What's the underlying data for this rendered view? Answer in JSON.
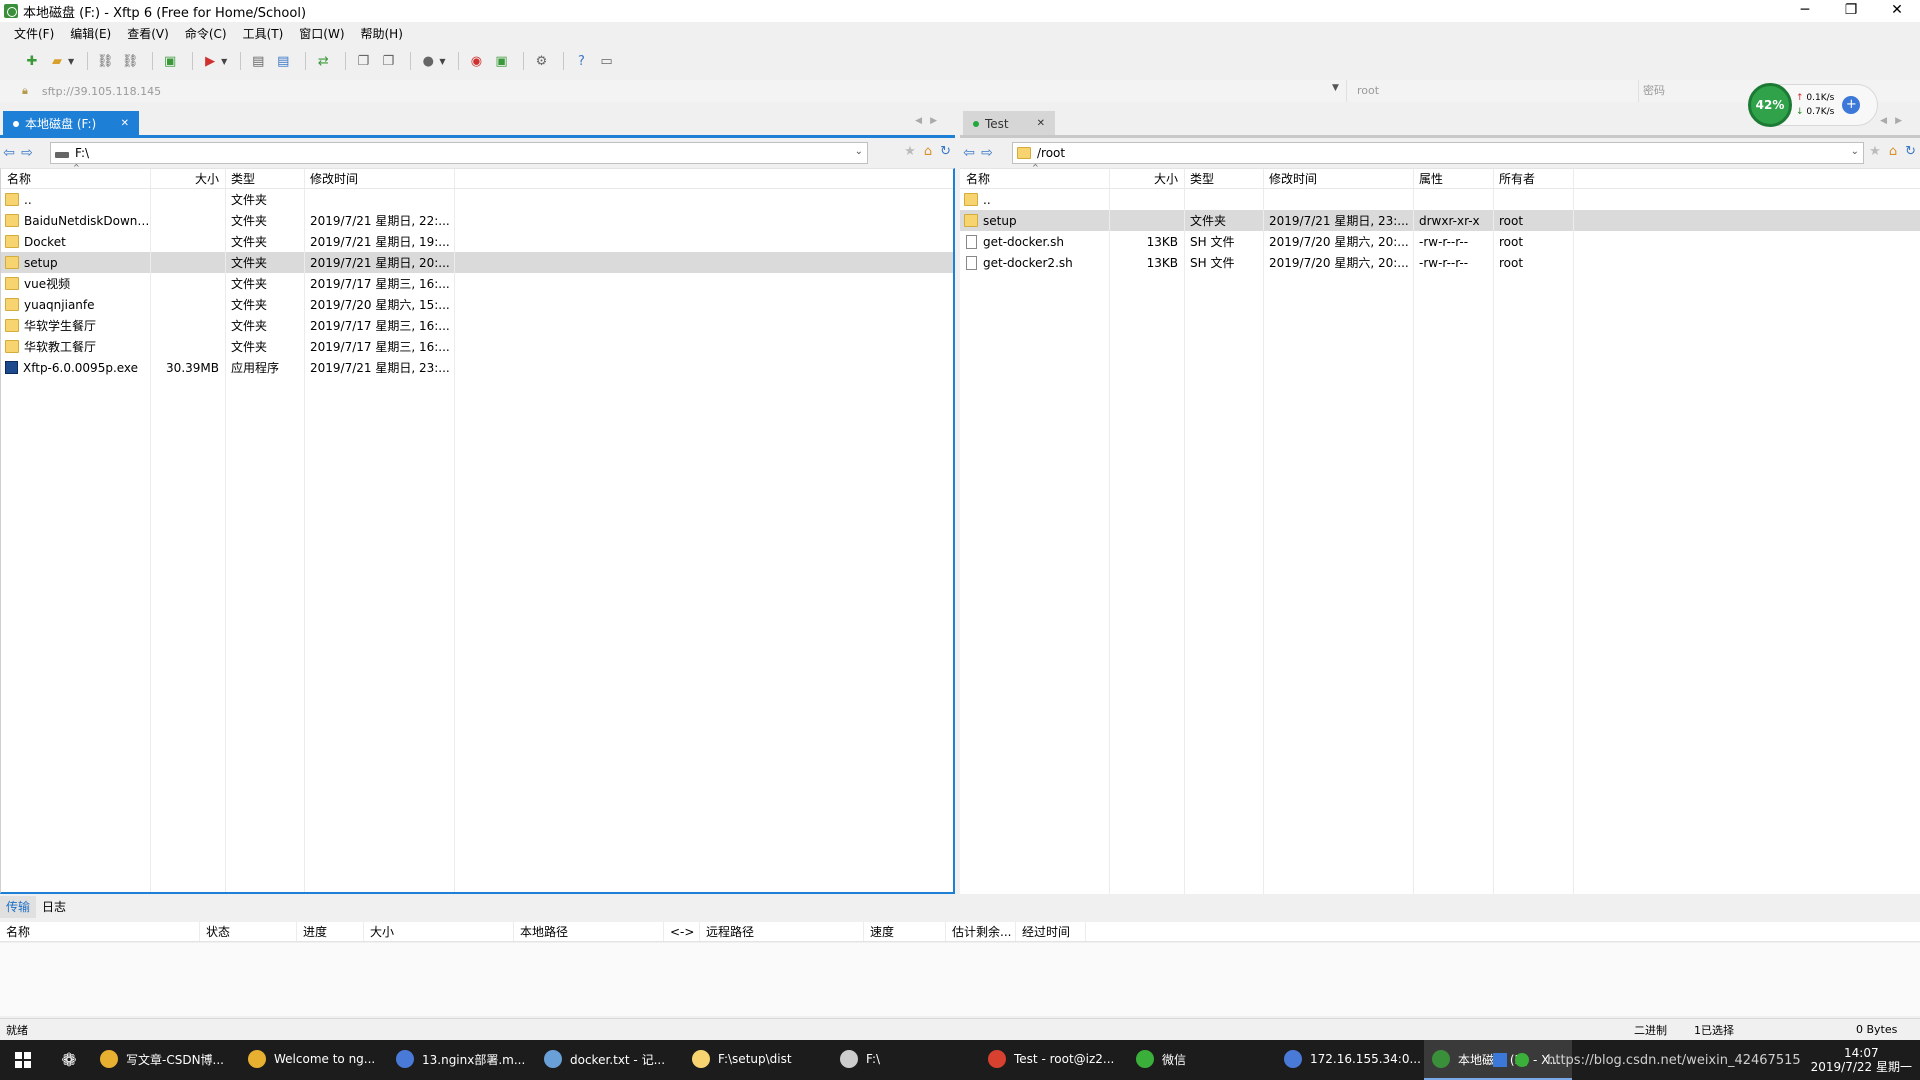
{
  "window": {
    "title": "本地磁盘 (F:) - Xftp 6 (Free for Home/School)",
    "min": "─",
    "restore": "❐",
    "close": "✕"
  },
  "menu": [
    "文件(F)",
    "编辑(E)",
    "查看(V)",
    "命令(C)",
    "工具(T)",
    "窗口(W)",
    "帮助(H)"
  ],
  "address": {
    "host": "sftp://39.105.118.145",
    "user": "root",
    "password": "密码"
  },
  "speed": {
    "percent": "42%",
    "up": "0.1K/s",
    "down": "0.7K/s"
  },
  "left": {
    "tab": "本地磁盘 (F:)",
    "path": "F:\\",
    "columns": [
      "名称",
      "大小",
      "类型",
      "修改时间"
    ],
    "rows": [
      {
        "name": "..",
        "size": "",
        "type": "文件夹",
        "time": "",
        "icon": "folder"
      },
      {
        "name": "BaiduNetdiskDownl...",
        "size": "",
        "type": "文件夹",
        "time": "2019/7/21 星期日, 22:...",
        "icon": "folder"
      },
      {
        "name": "Docket",
        "size": "",
        "type": "文件夹",
        "time": "2019/7/21 星期日, 19:...",
        "icon": "folder"
      },
      {
        "name": "setup",
        "size": "",
        "type": "文件夹",
        "time": "2019/7/21 星期日, 20:...",
        "icon": "folder",
        "selected": true
      },
      {
        "name": "vue视频",
        "size": "",
        "type": "文件夹",
        "time": "2019/7/17 星期三, 16:...",
        "icon": "folder"
      },
      {
        "name": "yuaqnjianfe",
        "size": "",
        "type": "文件夹",
        "time": "2019/7/20 星期六, 15:...",
        "icon": "folder"
      },
      {
        "name": "华软学生餐厅",
        "size": "",
        "type": "文件夹",
        "time": "2019/7/17 星期三, 16:...",
        "icon": "folder"
      },
      {
        "name": "华软教工餐厅",
        "size": "",
        "type": "文件夹",
        "time": "2019/7/17 星期三, 16:...",
        "icon": "folder"
      },
      {
        "name": "Xftp-6.0.0095p.exe",
        "size": "30.39MB",
        "type": "应用程序",
        "time": "2019/7/21 星期日, 23:...",
        "icon": "exe"
      }
    ]
  },
  "right": {
    "tab": "Test",
    "path": "/root",
    "columns": [
      "名称",
      "大小",
      "类型",
      "修改时间",
      "属性",
      "所有者"
    ],
    "rows": [
      {
        "name": "..",
        "size": "",
        "type": "",
        "time": "",
        "attr": "",
        "owner": "",
        "icon": "folder"
      },
      {
        "name": "setup",
        "size": "",
        "type": "文件夹",
        "time": "2019/7/21 星期日, 23:...",
        "attr": "drwxr-xr-x",
        "owner": "root",
        "icon": "folder",
        "selected": true
      },
      {
        "name": "get-docker.sh",
        "size": "13KB",
        "type": "SH 文件",
        "time": "2019/7/20 星期六, 20:...",
        "attr": "-rw-r--r--",
        "owner": "root",
        "icon": "file"
      },
      {
        "name": "get-docker2.sh",
        "size": "13KB",
        "type": "SH 文件",
        "time": "2019/7/20 星期六, 20:...",
        "attr": "-rw-r--r--",
        "owner": "root",
        "icon": "file"
      }
    ]
  },
  "transfer": {
    "tabs": [
      "传输",
      "日志"
    ],
    "columns": [
      "名称",
      "状态",
      "进度",
      "大小",
      "本地路径",
      "<->",
      "远程路径",
      "速度",
      "估计剩余...",
      "经过时间"
    ]
  },
  "status": {
    "ready": "就绪",
    "mode": "二进制",
    "selected": "1已选择",
    "bytes": "0 Bytes"
  },
  "taskbar": {
    "apps": [
      {
        "label": "写文章-CSDN博...",
        "color": "#e8b030"
      },
      {
        "label": "Welcome to ng...",
        "color": "#e8b030"
      },
      {
        "label": "13.nginx部署.m...",
        "color": "#4a7ad8"
      },
      {
        "label": "docker.txt - 记...",
        "color": "#6aa0d8"
      },
      {
        "label": "F:\\setup\\dist",
        "color": "#f8d471"
      },
      {
        "label": "F:\\",
        "color": "#cccccc"
      },
      {
        "label": "Test - root@iz2...",
        "color": "#d84030"
      },
      {
        "label": "微信",
        "color": "#3ab03a"
      },
      {
        "label": "172.16.155.34:0...",
        "color": "#4a7ad8"
      },
      {
        "label": "本地磁盘 (F:) - X...",
        "color": "#3a8f3a",
        "active": true
      }
    ],
    "watermark": "https://blog.csdn.net/weixin_42467515",
    "time": "14:07",
    "date": "2019/7/22 星期一"
  }
}
